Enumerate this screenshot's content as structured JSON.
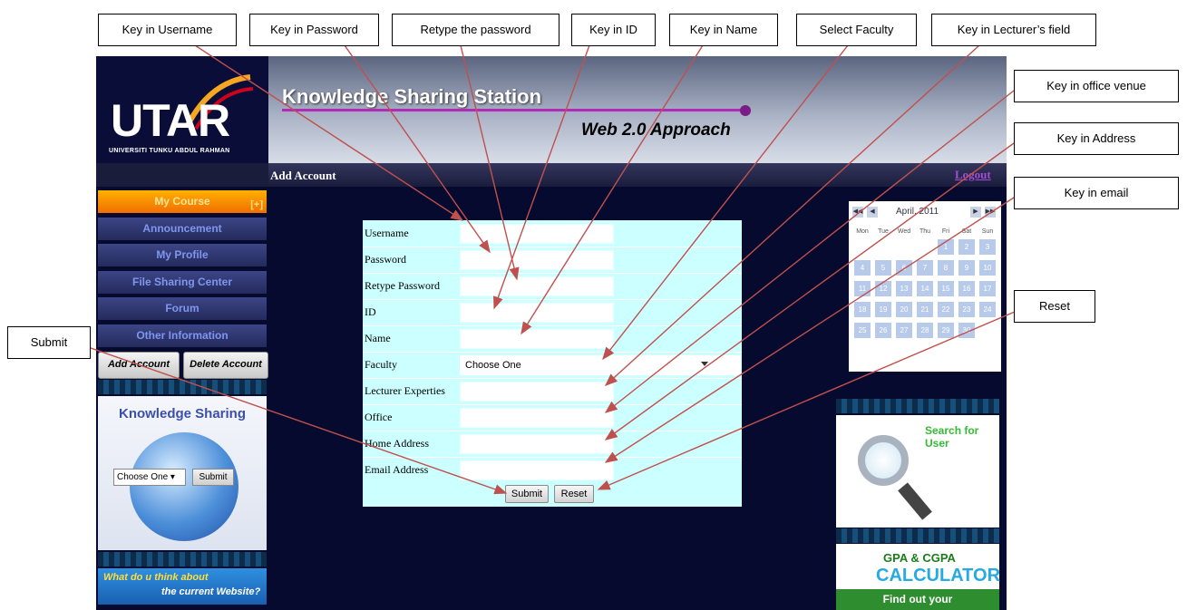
{
  "callouts": {
    "username": "Key in Username",
    "password": "Key in Password",
    "retype": "Retype the password",
    "id": "Key in ID",
    "name": "Key in Name",
    "faculty": "Select Faculty",
    "lecturer_field": "Key in Lecturer’s field",
    "office": "Key in office venue",
    "address": "Key in Address",
    "email": "Key in email",
    "reset": "Reset",
    "submit": "Submit"
  },
  "header": {
    "logo_text": "UTAR",
    "logo_subtext": "UNIVERSITI TUNKU ABDUL RAHMAN",
    "site_title": "Knowledge Sharing Station",
    "site_subtitle": "Web 2.0 Approach",
    "page_heading": "Add Account",
    "logout": "Logout"
  },
  "sidebar": {
    "items": [
      {
        "label": "My Course"
      },
      {
        "label": "Announcement"
      },
      {
        "label": "My Profile"
      },
      {
        "label": "File Sharing Center"
      },
      {
        "label": "Forum"
      },
      {
        "label": "Other Information"
      }
    ],
    "add_account": "Add Account",
    "delete_account": "Delete Account",
    "ks_title": "Knowledge Sharing",
    "ks_select": "Choose One",
    "ks_submit": "Submit",
    "feedback_line1": "What do u think about",
    "feedback_line2": "the current Website?"
  },
  "form": {
    "fields": [
      {
        "label": "Username",
        "value": ""
      },
      {
        "label": "Password",
        "value": ""
      },
      {
        "label": "Retype Password",
        "value": ""
      },
      {
        "label": "ID",
        "value": ""
      },
      {
        "label": "Name",
        "value": ""
      },
      {
        "label": "Faculty",
        "value": "Choose One"
      },
      {
        "label": "Lecturer Experties",
        "value": ""
      },
      {
        "label": "Office",
        "value": ""
      },
      {
        "label": "Home Address",
        "value": ""
      },
      {
        "label": "Email Address",
        "value": ""
      }
    ],
    "submit": "Submit",
    "reset": "Reset"
  },
  "calendar": {
    "month": "April, 2011",
    "nav_prev_year": "◀◀",
    "nav_prev": "◀",
    "nav_next": "▶",
    "nav_next_year": "▶▶",
    "weekdays": [
      "Mon",
      "Tue",
      "Wed",
      "Thu",
      "Fri",
      "Sat",
      "Sun"
    ],
    "days": [
      "1",
      "2",
      "3",
      "4",
      "5",
      "6",
      "7",
      "8",
      "9",
      "10",
      "11",
      "12",
      "13",
      "14",
      "15",
      "16",
      "17",
      "18",
      "19",
      "20",
      "21",
      "22",
      "23",
      "24",
      "25",
      "26",
      "27",
      "28",
      "29",
      "30"
    ]
  },
  "right": {
    "search_label": "Search for User",
    "gpa_line1": "GPA & CGPA",
    "gpa_line2": "CALCULATOR",
    "gpa_line3": "Find out your"
  },
  "colors": {
    "form_bg": "#ccffff",
    "site_bg": "#060a2e",
    "accent_line": "#b22ab8",
    "arrow": "#c0504d"
  }
}
